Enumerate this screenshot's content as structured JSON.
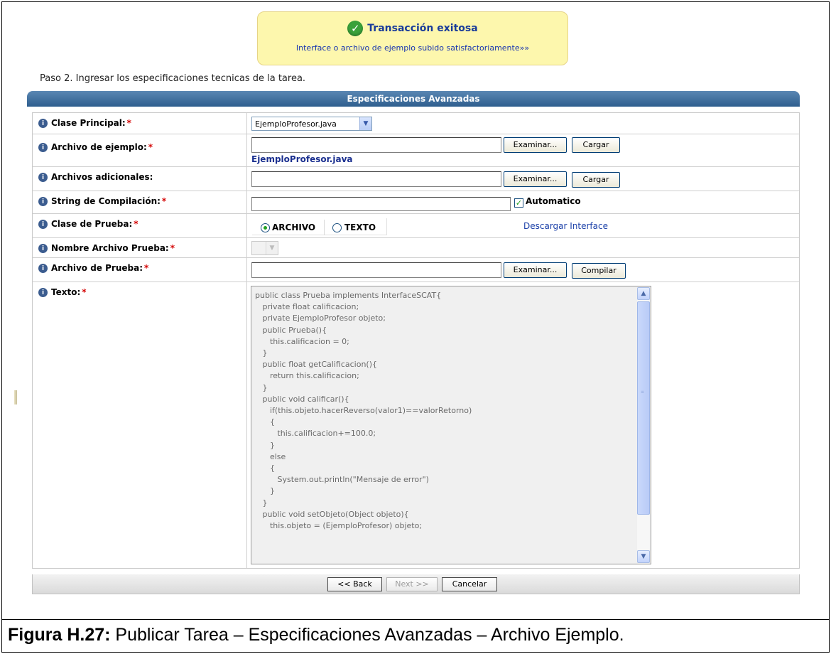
{
  "notification": {
    "title": "Transacción exitosa",
    "message": "Interface o archivo de ejemplo subido satisfactoriamente»»"
  },
  "step_text": "Paso 2. Ingresar los especificaciones tecnicas de la tarea.",
  "panel": {
    "title": "Especificaciones Avanzadas"
  },
  "form": {
    "clase_principal": {
      "label": "Clase Principal:",
      "selected": "EjemploProfesor.java"
    },
    "archivo_ejemplo": {
      "label": "Archivo de ejemplo:",
      "browse": "Examinar...",
      "upload": "Cargar",
      "file_link": "EjemploProfesor.java"
    },
    "archivos_adicionales": {
      "label": "Archivos adicionales:",
      "browse": "Examinar...",
      "upload": "Cargar"
    },
    "string_compilacion": {
      "label": "String de Compilación:",
      "value": "",
      "checkbox_label": "Automatico",
      "checked": true
    },
    "clase_prueba": {
      "label": "Clase de Prueba:",
      "option_archivo": "ARCHIVO",
      "option_texto": "TEXTO",
      "selected": "ARCHIVO",
      "download_link": "Descargar Interface"
    },
    "nombre_archivo_prueba": {
      "label": "Nombre Archivo Prueba:",
      "selected": ""
    },
    "archivo_prueba": {
      "label": "Archivo de Prueba:",
      "browse": "Examinar...",
      "compile": "Compilar"
    },
    "texto": {
      "label": "Texto:",
      "code": "public class Prueba implements InterfaceSCAT{\n   private float calificacion;\n   private EjemploProfesor objeto;\n   public Prueba(){\n      this.calificacion = 0;\n   }\n   public float getCalificacion(){\n      return this.calificacion;\n   }\n   public void calificar(){\n      if(this.objeto.hacerReverso(valor1)==valorRetorno)\n      {\n         this.calificacion+=100.0;\n      }\n      else\n      {\n         System.out.println(\"Mensaje de error\")\n      }\n   }\n   public void setObjeto(Object objeto){\n      this.objeto = (EjemploProfesor) objeto;"
    }
  },
  "footer": {
    "back": "<< Back",
    "next": "Next >>",
    "cancel": "Cancelar"
  },
  "caption": {
    "label": "Figura H.27:",
    "text": " Publicar Tarea – Especificaciones Avanzadas – Archivo Ejemplo."
  }
}
